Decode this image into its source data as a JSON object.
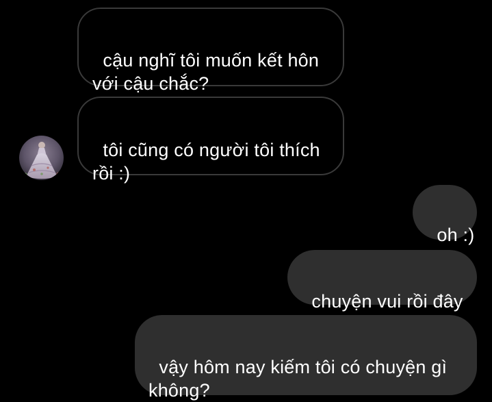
{
  "incoming_messages": [
    {
      "text": "cậu nghĩ tôi muốn kết hôn\nvới cậu chắc?"
    },
    {
      "text": "tôi cũng có người tôi thích\nrồi :)"
    }
  ],
  "outgoing_messages": [
    {
      "text": "oh :)"
    },
    {
      "text": "chuyện vui rồi đây"
    },
    {
      "text": "vậy hôm nay kiếm tôi có chuyện gì\nkhông?"
    }
  ],
  "colors": {
    "background": "#000000",
    "incoming_border": "#3a3a3a",
    "outgoing_fill": "#2f2f2f",
    "text": "#ffffff"
  }
}
